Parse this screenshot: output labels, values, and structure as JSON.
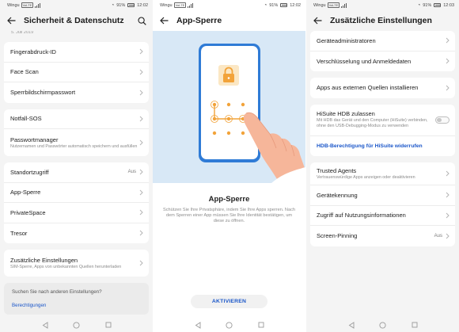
{
  "status": {
    "carrier": "Wingu",
    "carrier_badge": "VoLTE",
    "battery": "91%",
    "time_p1": "12:02",
    "time_p2": "12:02",
    "time_p3": "12:03"
  },
  "panel1": {
    "title": "Sicherheit & Datenschutz",
    "cutoff_text": "5. Juli 2019",
    "groups": [
      {
        "items": [
          {
            "label": "Fingerabdruck-ID"
          },
          {
            "label": "Face Scan"
          },
          {
            "label": "Sperrbildschirmpasswort"
          }
        ]
      },
      {
        "items": [
          {
            "label": "Notfall-SOS"
          },
          {
            "label": "Passwortmanager",
            "sub": "Nutzernamen und Passwörter automatisch speichern und ausfüllen"
          }
        ]
      },
      {
        "items": [
          {
            "label": "Standortzugriff",
            "value": "Aus"
          },
          {
            "label": "App-Sperre"
          },
          {
            "label": "PrivateSpace"
          },
          {
            "label": "Tresor"
          }
        ]
      },
      {
        "items": [
          {
            "label": "Zusätzliche Einstellungen",
            "sub": "SIM-Sperre, Apps von unbekannten Quellen herunterladen"
          }
        ]
      }
    ],
    "suggest_question": "Suchen Sie nach anderen Einstellungen?",
    "suggest_link": "Berechtigungen"
  },
  "panel2": {
    "title": "App-Sperre",
    "heading": "App-Sperre",
    "description": "Schützen Sie Ihre Privatsphäre, indem Sie Ihre Apps sperren. Nach dem Sperren einer App müssen Sie Ihre Identität bestätigen, um diese zu öffnen.",
    "button": "AKTIVIEREN"
  },
  "panel3": {
    "title": "Zusätzliche Einstellungen",
    "groups": [
      {
        "items": [
          {
            "label": "Geräteadministratoren"
          },
          {
            "label": "Verschlüsselung und Anmeldedaten"
          }
        ]
      },
      {
        "items": [
          {
            "label": "Apps aus externen Quellen installieren"
          }
        ]
      }
    ],
    "hdb": {
      "label": "HiSuite HDB zulassen",
      "sub": "Mit HDB das Gerät und den Computer (HiSuite) verbinden, ohne den USB-Debugging-Modus zu verwenden",
      "link": "HDB-Berechtigung für HiSuite widerrufen"
    },
    "group3": [
      {
        "label": "Trusted Agents",
        "sub": "Vertrauenswürdige Apps anzeigen oder deaktivieren"
      },
      {
        "label": "Gerätekennung"
      },
      {
        "label": "Zugriff auf Nutzungsinformationen"
      },
      {
        "label": "Screen-Pinning",
        "value": "Aus"
      }
    ]
  },
  "colors": {
    "accent": "#1a56c9",
    "illustration_bg": "#d8e8f6",
    "phone_blue": "#2f7bd6",
    "pattern_orange": "#f2a33a"
  },
  "icons": [
    "back-arrow-icon",
    "search-icon",
    "chevron-right-icon",
    "lock-icon",
    "hand-icon",
    "nav-back-icon",
    "nav-home-icon",
    "nav-recents-icon",
    "wifi-icon",
    "signal-icon",
    "battery-icon"
  ]
}
